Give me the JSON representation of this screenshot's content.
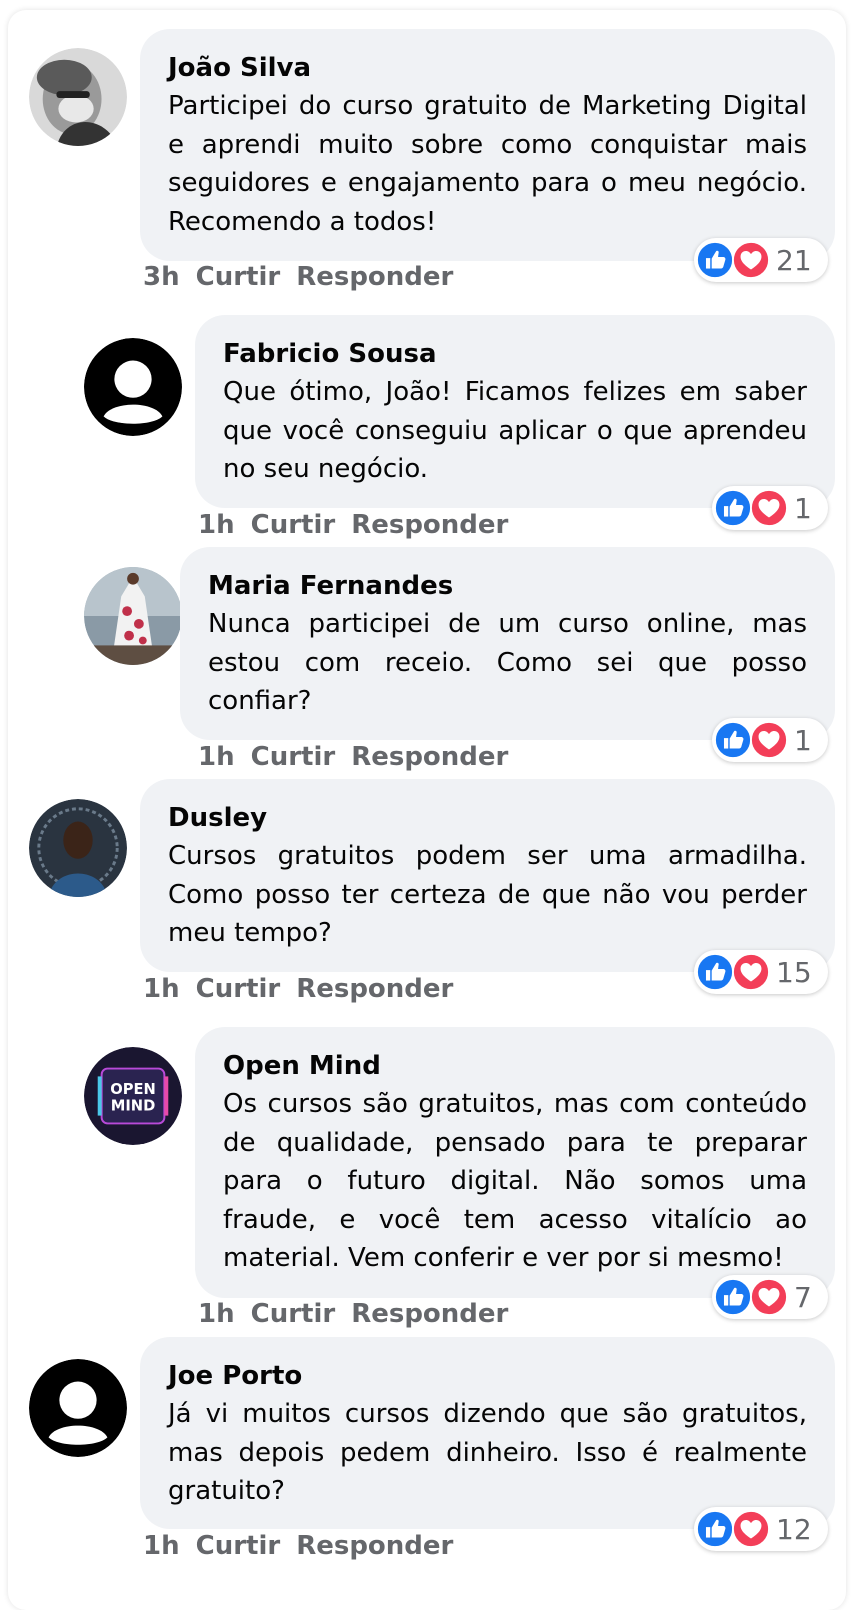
{
  "theme": {
    "bubble_bg": "#f0f2f5",
    "meta_color": "#65676b",
    "like_color": "#1877f2",
    "love_color": "#f33e58"
  },
  "comments": [
    {
      "author": "João Silva",
      "avatar": "photo-elderly-man-avatar",
      "text": "Participei do curso gratuito de Marketing Digital e aprendi muito sobre como conquistar mais seguidores e engajamento para o meu negócio. Recomendo a todos!",
      "time": "3h",
      "like_label": "Curtir",
      "reply_label": "Responder",
      "reactions": [
        "like-icon",
        "heart-icon"
      ],
      "reaction_count": "21"
    },
    {
      "author": "Fabricio Sousa",
      "avatar": "default-user-avatar",
      "text": "Que ótimo, João! Ficamos felizes em saber que você conseguiu aplicar o que aprendeu no seu negócio.",
      "time": "1h",
      "like_label": "Curtir",
      "reply_label": "Responder",
      "reactions": [
        "like-icon",
        "heart-icon"
      ],
      "reaction_count": "1"
    },
    {
      "author": "Maria Fernandes",
      "avatar": "photo-woman-floral-dress-avatar",
      "text": "Nunca participei de um curso online, mas estou com receio. Como sei que posso confiar?",
      "time": "1h",
      "like_label": "Curtir",
      "reply_label": "Responder",
      "reactions": [
        "like-icon",
        "heart-icon"
      ],
      "reaction_count": "1"
    },
    {
      "author": "Dusley",
      "avatar": "photo-young-man-avatar",
      "text": "Cursos gratuitos podem ser uma armadilha. Como posso ter certeza de que não vou perder meu tempo?",
      "time": "1h",
      "like_label": "Curtir",
      "reply_label": "Responder",
      "reactions": [
        "like-icon",
        "heart-icon"
      ],
      "reaction_count": "15"
    },
    {
      "author": "Open Mind",
      "avatar": "open-mind-logo-avatar",
      "avatar_text_1": "OPEN",
      "avatar_text_2": "MIND",
      "text": "Os cursos são gratuitos, mas com conteúdo de qualidade, pensado para te preparar para o futuro digital. Não somos uma fraude, e você tem acesso vitalício ao material. Vem conferir e ver por si mesmo!",
      "time": "1h",
      "like_label": "Curtir",
      "reply_label": "Responder",
      "reactions": [
        "like-icon",
        "heart-icon"
      ],
      "reaction_count": "7"
    },
    {
      "author": "Joe Porto",
      "avatar": "default-user-avatar",
      "text": "Já vi muitos cursos dizendo que são gratuitos, mas depois pedem dinheiro. Isso é realmente gratuito?",
      "time": "1h",
      "like_label": "Curtir",
      "reply_label": "Responder",
      "reactions": [
        "like-icon",
        "heart-icon"
      ],
      "reaction_count": "12"
    }
  ]
}
